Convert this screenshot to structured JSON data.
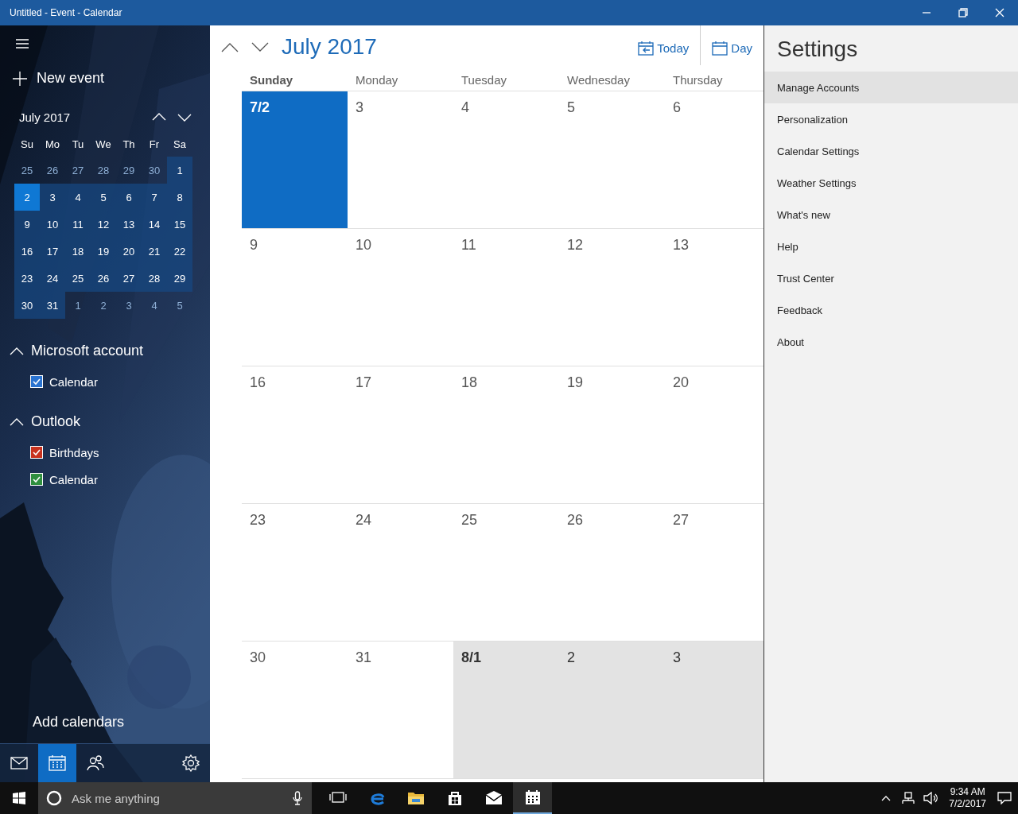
{
  "window": {
    "title": "Untitled - Event - Calendar"
  },
  "sidebar": {
    "new_event": "New event",
    "mini_calendar": {
      "title": "July 2017",
      "weekdays": [
        "Su",
        "Mo",
        "Tu",
        "We",
        "Th",
        "Fr",
        "Sa"
      ],
      "weeks": [
        [
          {
            "day": "25",
            "current_month": false,
            "selected": false
          },
          {
            "day": "26",
            "current_month": false,
            "selected": false
          },
          {
            "day": "27",
            "current_month": false,
            "selected": false
          },
          {
            "day": "28",
            "current_month": false,
            "selected": false
          },
          {
            "day": "29",
            "current_month": false,
            "selected": false
          },
          {
            "day": "30",
            "current_month": false,
            "selected": false
          },
          {
            "day": "1",
            "current_month": true,
            "selected": false
          }
        ],
        [
          {
            "day": "2",
            "current_month": true,
            "selected": true
          },
          {
            "day": "3",
            "current_month": true,
            "selected": false
          },
          {
            "day": "4",
            "current_month": true,
            "selected": false
          },
          {
            "day": "5",
            "current_month": true,
            "selected": false
          },
          {
            "day": "6",
            "current_month": true,
            "selected": false
          },
          {
            "day": "7",
            "current_month": true,
            "selected": false
          },
          {
            "day": "8",
            "current_month": true,
            "selected": false
          }
        ],
        [
          {
            "day": "9",
            "current_month": true,
            "selected": false
          },
          {
            "day": "10",
            "current_month": true,
            "selected": false
          },
          {
            "day": "11",
            "current_month": true,
            "selected": false
          },
          {
            "day": "12",
            "current_month": true,
            "selected": false
          },
          {
            "day": "13",
            "current_month": true,
            "selected": false
          },
          {
            "day": "14",
            "current_month": true,
            "selected": false
          },
          {
            "day": "15",
            "current_month": true,
            "selected": false
          }
        ],
        [
          {
            "day": "16",
            "current_month": true,
            "selected": false
          },
          {
            "day": "17",
            "current_month": true,
            "selected": false
          },
          {
            "day": "18",
            "current_month": true,
            "selected": false
          },
          {
            "day": "19",
            "current_month": true,
            "selected": false
          },
          {
            "day": "20",
            "current_month": true,
            "selected": false
          },
          {
            "day": "21",
            "current_month": true,
            "selected": false
          },
          {
            "day": "22",
            "current_month": true,
            "selected": false
          }
        ],
        [
          {
            "day": "23",
            "current_month": true,
            "selected": false
          },
          {
            "day": "24",
            "current_month": true,
            "selected": false
          },
          {
            "day": "25",
            "current_month": true,
            "selected": false
          },
          {
            "day": "26",
            "current_month": true,
            "selected": false
          },
          {
            "day": "27",
            "current_month": true,
            "selected": false
          },
          {
            "day": "28",
            "current_month": true,
            "selected": false
          },
          {
            "day": "29",
            "current_month": true,
            "selected": false
          }
        ],
        [
          {
            "day": "30",
            "current_month": true,
            "selected": false
          },
          {
            "day": "31",
            "current_month": true,
            "selected": false
          },
          {
            "day": "1",
            "current_month": false,
            "selected": false
          },
          {
            "day": "2",
            "current_month": false,
            "selected": false
          },
          {
            "day": "3",
            "current_month": false,
            "selected": false
          },
          {
            "day": "4",
            "current_month": false,
            "selected": false
          },
          {
            "day": "5",
            "current_month": false,
            "selected": false
          }
        ]
      ]
    },
    "groups": [
      {
        "name": "Microsoft account",
        "expanded": true,
        "calendars": [
          {
            "name": "Calendar",
            "checked": true,
            "color": "#2a73d0"
          }
        ]
      },
      {
        "name": "Outlook",
        "expanded": true,
        "calendars": [
          {
            "name": "Birthdays",
            "checked": true,
            "color": "#c8321e"
          },
          {
            "name": "Calendar",
            "checked": true,
            "color": "#2f8f3e"
          }
        ]
      }
    ],
    "add_calendars": "Add calendars",
    "nav": [
      {
        "kind": "mail",
        "selected": false
      },
      {
        "kind": "calendar",
        "selected": true
      },
      {
        "kind": "people",
        "selected": false
      },
      {
        "kind": "settings",
        "selected": false
      }
    ]
  },
  "main": {
    "title": "July 2017",
    "toolbar": [
      {
        "kind": "today",
        "label": "Today"
      },
      {
        "kind": "day",
        "label": "Day"
      }
    ],
    "weekdays": [
      {
        "label": "Sunday",
        "today": true
      },
      {
        "label": "Monday",
        "today": false
      },
      {
        "label": "Tuesday",
        "today": false
      },
      {
        "label": "Wednesday",
        "today": false
      },
      {
        "label": "Thursday",
        "today": false
      }
    ],
    "weeks": [
      [
        {
          "label": "7/2",
          "today": true,
          "next_month": false,
          "month_start": false
        },
        {
          "label": "3",
          "today": false,
          "next_month": false,
          "month_start": false
        },
        {
          "label": "4",
          "today": false,
          "next_month": false,
          "month_start": false
        },
        {
          "label": "5",
          "today": false,
          "next_month": false,
          "month_start": false
        },
        {
          "label": "6",
          "today": false,
          "next_month": false,
          "month_start": false
        }
      ],
      [
        {
          "label": "9",
          "today": false,
          "next_month": false,
          "month_start": false
        },
        {
          "label": "10",
          "today": false,
          "next_month": false,
          "month_start": false
        },
        {
          "label": "11",
          "today": false,
          "next_month": false,
          "month_start": false
        },
        {
          "label": "12",
          "today": false,
          "next_month": false,
          "month_start": false
        },
        {
          "label": "13",
          "today": false,
          "next_month": false,
          "month_start": false
        }
      ],
      [
        {
          "label": "16",
          "today": false,
          "next_month": false,
          "month_start": false
        },
        {
          "label": "17",
          "today": false,
          "next_month": false,
          "month_start": false
        },
        {
          "label": "18",
          "today": false,
          "next_month": false,
          "month_start": false
        },
        {
          "label": "19",
          "today": false,
          "next_month": false,
          "month_start": false
        },
        {
          "label": "20",
          "today": false,
          "next_month": false,
          "month_start": false
        }
      ],
      [
        {
          "label": "23",
          "today": false,
          "next_month": false,
          "month_start": false
        },
        {
          "label": "24",
          "today": false,
          "next_month": false,
          "month_start": false
        },
        {
          "label": "25",
          "today": false,
          "next_month": false,
          "month_start": false
        },
        {
          "label": "26",
          "today": false,
          "next_month": false,
          "month_start": false
        },
        {
          "label": "27",
          "today": false,
          "next_month": false,
          "month_start": false
        }
      ],
      [
        {
          "label": "30",
          "today": false,
          "next_month": false,
          "month_start": false
        },
        {
          "label": "31",
          "today": false,
          "next_month": false,
          "month_start": false
        },
        {
          "label": "8/1",
          "today": false,
          "next_month": true,
          "month_start": true
        },
        {
          "label": "2",
          "today": false,
          "next_month": true,
          "month_start": false
        },
        {
          "label": "3",
          "today": false,
          "next_month": true,
          "month_start": false
        }
      ]
    ]
  },
  "settings": {
    "title": "Settings",
    "items": [
      {
        "label": "Manage Accounts",
        "selected": true
      },
      {
        "label": "Personalization",
        "selected": false
      },
      {
        "label": "Calendar Settings",
        "selected": false
      },
      {
        "label": "Weather Settings",
        "selected": false
      },
      {
        "label": "What's new",
        "selected": false
      },
      {
        "label": "Help",
        "selected": false
      },
      {
        "label": "Trust Center",
        "selected": false
      },
      {
        "label": "Feedback",
        "selected": false
      },
      {
        "label": "About",
        "selected": false
      }
    ]
  },
  "taskbar": {
    "search_placeholder": "Ask me anything",
    "apps": [
      {
        "kind": "task_view",
        "active": false
      },
      {
        "kind": "browser",
        "active": false
      },
      {
        "kind": "folder",
        "active": false
      },
      {
        "kind": "store",
        "active": false
      },
      {
        "kind": "mail",
        "active": false
      },
      {
        "kind": "calendar",
        "active": true
      }
    ],
    "time": "9:34 AM",
    "date": "7/2/2017"
  }
}
